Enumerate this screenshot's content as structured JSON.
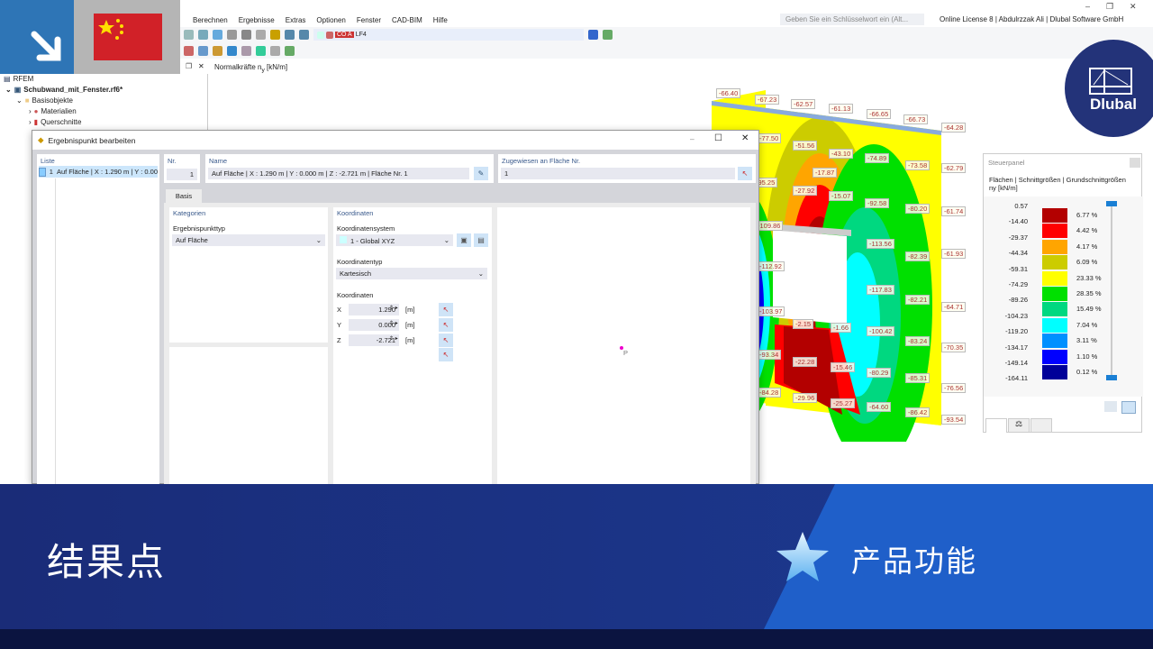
{
  "app": {
    "menu": [
      "Berechnen",
      "Ergebnisse",
      "Extras",
      "Optionen",
      "Fenster",
      "CAD-BIM",
      "Hilfe"
    ],
    "search_placeholder": "Geben Sie ein Schlüsselwort ein (Alt...",
    "license": "Online License 8 | Abdulrzzak Ali | Dlubal Software GmbH",
    "loadcase_badge": "CO A",
    "loadcase": "LF4",
    "view_title": "Normalkräfte n",
    "view_title_sub": "y",
    "view_title_unit": " [kN/m]"
  },
  "tree": {
    "root": "RFEM",
    "file": "Schubwand_mit_Fenster.rf6*",
    "items": [
      "Basisobjekte",
      "Materialien",
      "Querschnitte"
    ]
  },
  "dialog": {
    "title": "Ergebnispunkt bearbeiten",
    "list_header": "Liste",
    "list_items": [
      {
        "no": "1",
        "label": "Auf Fläche | X : 1.290 m | Y : 0.00"
      }
    ],
    "nr_label": "Nr.",
    "nr_value": "1",
    "name_label": "Name",
    "name_value": "Auf Fläche | X : 1.290 m | Y : 0.000 m | Z : -2.721 m | Fläche Nr. 1",
    "assigned_label": "Zugewiesen an Fläche Nr.",
    "assigned_value": "1",
    "tab": "Basis",
    "kategorien": "Kategorien",
    "typ_label": "Ergebnispunkttyp",
    "typ_value": "Auf Fläche",
    "koordinaten": "Koordinaten",
    "ks_label": "Koordinatensystem",
    "ks_value": "1 - Global XYZ",
    "kt_label": "Koordinatentyp",
    "kt_value": "Kartesisch",
    "coords_label": "Koordinaten",
    "coords": [
      {
        "axis": "X",
        "value": "1.290",
        "unit": "[m]"
      },
      {
        "axis": "Y",
        "value": "0.000",
        "unit": "[m]"
      },
      {
        "axis": "Z",
        "value": "-2.721",
        "unit": "[m]"
      }
    ],
    "preview_point": "P"
  },
  "model_values": [
    "-66.40",
    "-67.23",
    "-62.57",
    "-61.13",
    "-66.65",
    "-66.73",
    "-64.28",
    "-77.50",
    "-51.56",
    "-43.10",
    "-74.89",
    "-73.58",
    "-62.79",
    "-17.87",
    "-95.25",
    "-27.92",
    "-15.07",
    "-92.58",
    "-80.20",
    "-61.74",
    "-109.86",
    "-113.56",
    "-82.39",
    "-61.93",
    "-112.92",
    "-117.83",
    "-82.21",
    "-64.71",
    "-103.97",
    "-2.15",
    "-1.66",
    "-100.42",
    "-83.24",
    "-70.35",
    "-93.34",
    "-22.28",
    "-15.46",
    "-80.29",
    "-85.31",
    "-76.56",
    "-84.28",
    "-29.96",
    "-25.27",
    "-64.60",
    "-86.42",
    "-93.54"
  ],
  "steuerpanel": {
    "title": "Steuerpanel",
    "subtitle": "Flächen | Schnittgrößen | Grundschnittgrößen",
    "quantity": "ny [kN/m]",
    "ticks": [
      "0.57",
      "-14.40",
      "-29.37",
      "-44.34",
      "-59.31",
      "-74.29",
      "-89.26",
      "-104.23",
      "-119.20",
      "-134.17",
      "-149.14",
      "-164.11"
    ],
    "bands": [
      {
        "color": "#b30000",
        "pct": "6.77 %"
      },
      {
        "color": "#ff0000",
        "pct": "4.42 %"
      },
      {
        "color": "#ffa500",
        "pct": "4.17 %"
      },
      {
        "color": "#cccc00",
        "pct": "6.09 %"
      },
      {
        "color": "#ffff00",
        "pct": "23.33 %"
      },
      {
        "color": "#00e000",
        "pct": "28.35 %"
      },
      {
        "color": "#00d880",
        "pct": "15.49 %"
      },
      {
        "color": "#00ffff",
        "pct": "7.04 %"
      },
      {
        "color": "#0090ff",
        "pct": "3.11 %"
      },
      {
        "color": "#0000ff",
        "pct": "1.10 %"
      },
      {
        "color": "#000099",
        "pct": "0.12 %"
      }
    ]
  },
  "banner": {
    "title": "结果点",
    "feature": "产品功能",
    "brand": "Dlubal"
  },
  "colors": {
    "banner": "#1a2c78",
    "banner_right": "#1f5fc9",
    "brand_circle": "#233379",
    "accent": "#2e75b6"
  }
}
